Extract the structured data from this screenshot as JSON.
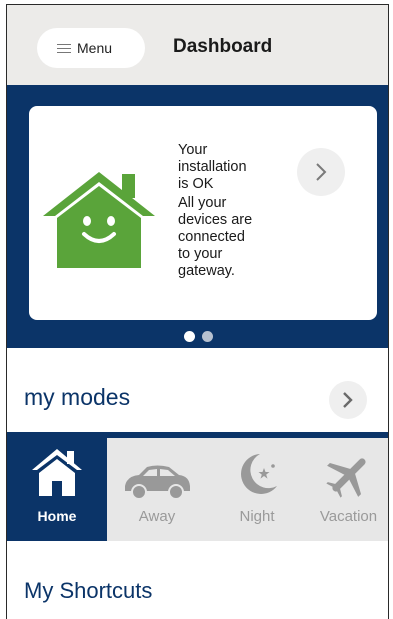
{
  "header": {
    "menu_label": "Menu",
    "title": "Dashboard"
  },
  "status_card": {
    "line1": "Your",
    "line2": "installation",
    "line3": "is OK",
    "line4": "All your",
    "line5": "devices are",
    "line6": "connected",
    "line7": "to your",
    "line8": "gateway.",
    "icon": "smiling-house-icon",
    "arrow_icon": "chevron-right-icon"
  },
  "carousel": {
    "active_index": 0,
    "count": 2
  },
  "modes": {
    "title": "my modes",
    "tabs": [
      {
        "label": "Home",
        "icon": "house-icon",
        "active": true
      },
      {
        "label": "Away",
        "icon": "car-icon",
        "active": false
      },
      {
        "label": "Night",
        "icon": "moon-icon",
        "active": false
      },
      {
        "label": "Vacation",
        "icon": "airplane-icon",
        "active": false
      }
    ]
  },
  "shortcuts": {
    "title": "My Shortcuts"
  },
  "colors": {
    "brand_navy": "#0b3468",
    "house_green": "#5aa43a",
    "header_bg": "#ecebe9"
  }
}
